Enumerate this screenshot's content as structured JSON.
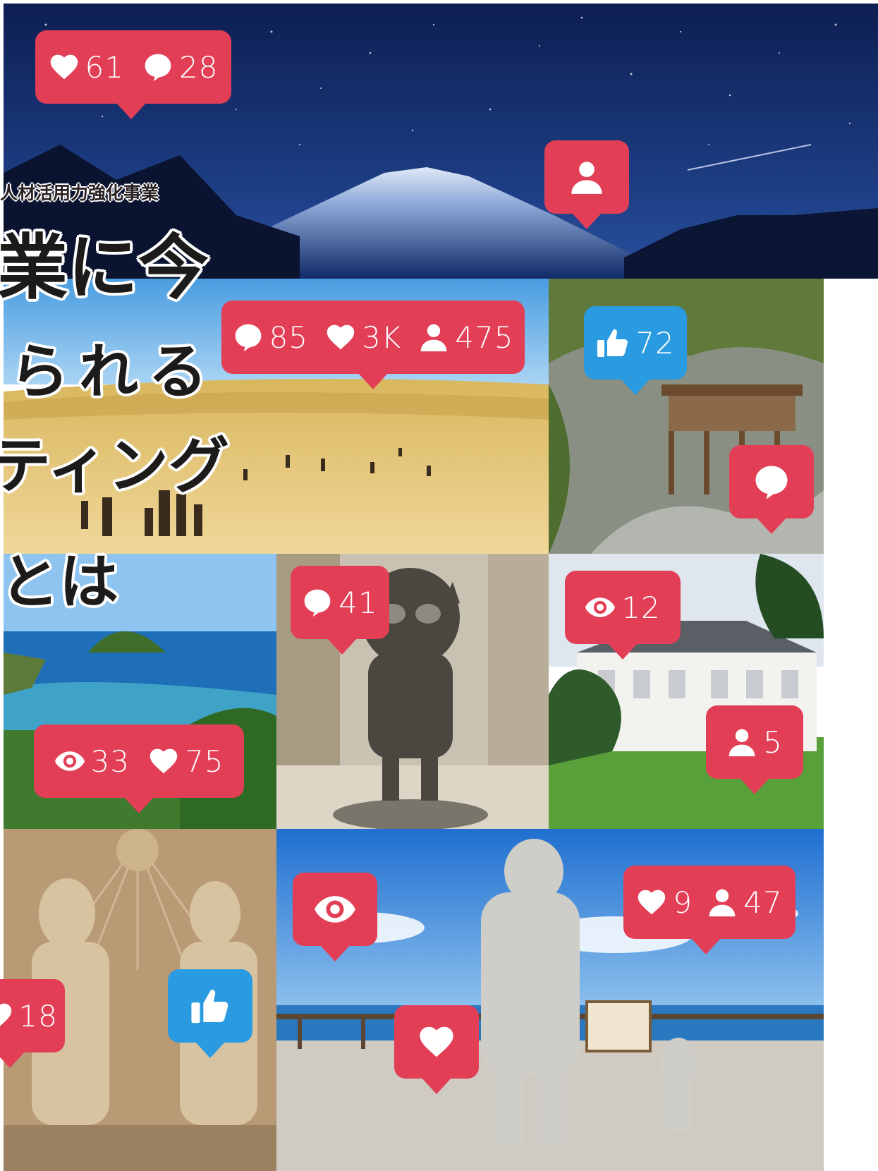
{
  "heading": {
    "subtitle": "人材活用力強化事業",
    "lines": [
      "業に今",
      "られる",
      "ティング",
      "とは"
    ]
  },
  "badges": {
    "night_sky": [
      {
        "icon": "heart-icon",
        "value": "61"
      },
      {
        "icon": "comment-icon",
        "value": "28"
      }
    ],
    "night_sky_user": {
      "icon": "user-icon"
    },
    "dunes": [
      {
        "icon": "comment-icon",
        "value": "85"
      },
      {
        "icon": "heart-icon",
        "value": "3K"
      },
      {
        "icon": "user-icon",
        "value": "475"
      }
    ],
    "temple": [
      {
        "icon": "thumbs-up-icon",
        "value": "72"
      }
    ],
    "temple_comment": {
      "icon": "comment-icon"
    },
    "coast": [
      {
        "icon": "eye-icon",
        "value": "33"
      },
      {
        "icon": "heart-icon",
        "value": "75"
      }
    ],
    "statue": [
      {
        "icon": "comment-icon",
        "value": "41"
      }
    ],
    "mansion": [
      {
        "icon": "eye-icon",
        "value": "12"
      }
    ],
    "mansion_user": [
      {
        "icon": "user-icon",
        "value": "5"
      }
    ],
    "sand_left": [
      {
        "icon": "heart-icon",
        "value": "18"
      }
    ],
    "sand_like": {
      "icon": "thumbs-up-icon"
    },
    "seaside_eye": {
      "icon": "eye-icon"
    },
    "seaside": [
      {
        "icon": "heart-icon",
        "value": "9"
      },
      {
        "icon": "user-icon",
        "value": "47"
      }
    ],
    "seaside_heart": {
      "icon": "heart-icon"
    }
  },
  "colors": {
    "badge_red": "#e23f57",
    "badge_blue": "#2a9be0"
  }
}
